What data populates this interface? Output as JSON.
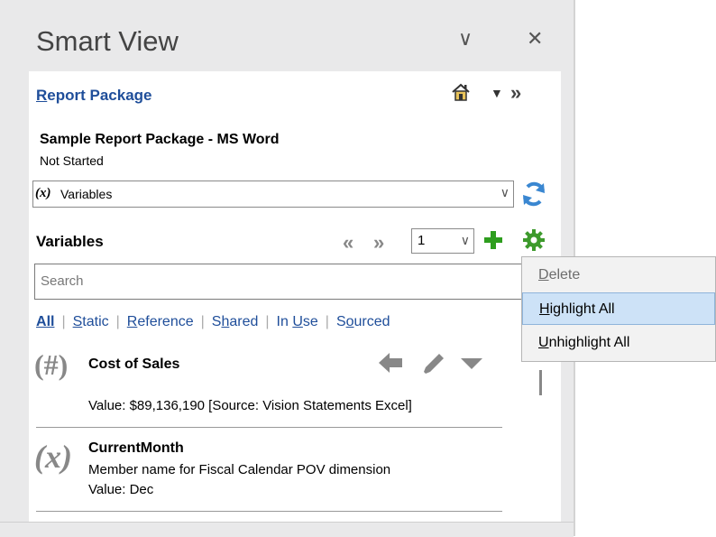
{
  "pane": {
    "title": "Smart View",
    "minimize_glyph": "∨",
    "close_glyph": "✕"
  },
  "header": {
    "report_package_label_first": "R",
    "report_package_label_rest": "eport Package",
    "home_icon": "home-icon",
    "dropdown_glyph": "▼",
    "expand_glyph": "»"
  },
  "document": {
    "name": "Sample Report Package - MS Word",
    "status": "Not Started"
  },
  "view_selector": {
    "symbol": "(x)",
    "value": "Variables",
    "caret": "∨"
  },
  "variables_toolbar": {
    "heading": "Variables",
    "prev_glyph": "«",
    "next_glyph": "»",
    "page_value": "1",
    "caret": "∨"
  },
  "search": {
    "placeholder": "Search",
    "value": ""
  },
  "filters": [
    {
      "pre": "",
      "u": "A",
      "post": "ll",
      "active": true
    },
    {
      "pre": "",
      "u": "S",
      "post": "tatic",
      "active": false
    },
    {
      "pre": "",
      "u": "R",
      "post": "eference",
      "active": false
    },
    {
      "pre": "S",
      "u": "h",
      "post": "ared",
      "active": false
    },
    {
      "pre": "In ",
      "u": "U",
      "post": "se",
      "active": false
    },
    {
      "pre": "S",
      "u": "o",
      "post": "urced",
      "active": false
    }
  ],
  "variables": [
    {
      "symbol": "(#)",
      "name": "Cost of Sales",
      "value": "Value:  $89,136,190  [Source: Vision Statements Excel]"
    },
    {
      "symbol": "(x)",
      "name": "CurrentMonth",
      "description": "Member name for Fiscal Calendar POV dimension",
      "value": "Value: Dec"
    }
  ],
  "context_menu": {
    "items": [
      {
        "u": "D",
        "rest": "elete",
        "state": "disabled"
      },
      {
        "u": "H",
        "rest": "ighlight All",
        "state": "highlighted"
      },
      {
        "u": "U",
        "rest": "nhighlight All",
        "state": "normal"
      }
    ]
  },
  "colors": {
    "link": "#1f4e9a",
    "pane_background": "#e9e9ea",
    "menu_highlight": "#cde2f7",
    "add_green": "#2e9d1e"
  }
}
